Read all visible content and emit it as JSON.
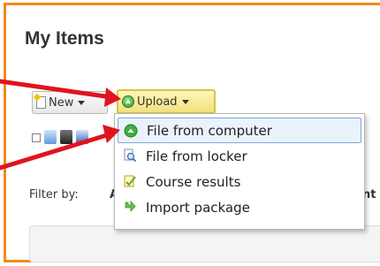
{
  "page": {
    "title": "My Items"
  },
  "toolbar": {
    "new_label": "New",
    "upload_label": "Upload"
  },
  "upload_menu": {
    "items": [
      {
        "label": "File from computer",
        "icon": "upload-icon",
        "highlighted": true
      },
      {
        "label": "File from locker",
        "icon": "locker-search-icon",
        "highlighted": false
      },
      {
        "label": "Course results",
        "icon": "course-results-icon",
        "highlighted": false
      },
      {
        "label": "Import package",
        "icon": "import-arrow-icon",
        "highlighted": false
      }
    ]
  },
  "filter": {
    "label": "Filter by:",
    "truncated_a": "A",
    "truncated_b": "nt"
  },
  "colors": {
    "panel_border": "#f08a1c",
    "arrow": "#e0141e",
    "upload_button_bg": "#f3e07e",
    "menu_highlight": "#eaf2fc"
  }
}
